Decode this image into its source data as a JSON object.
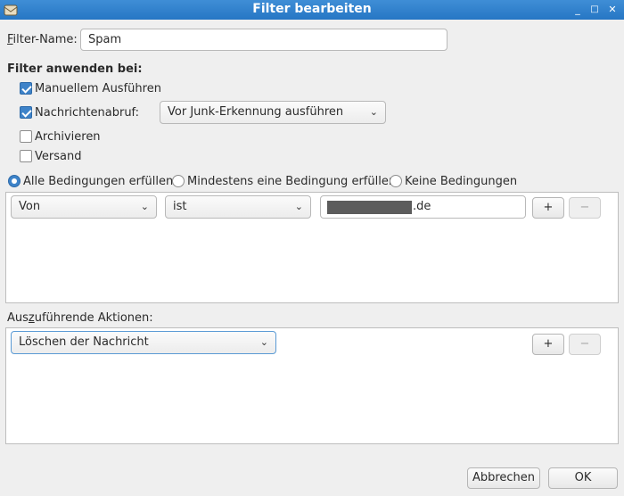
{
  "window": {
    "title": "Filter bearbeiten",
    "minimize": "_",
    "maximize": "□",
    "close": "✕"
  },
  "filter_name": {
    "label": "Filter-Name:",
    "value": "Spam"
  },
  "apply": {
    "heading": "Filter anwenden bei:",
    "manual": {
      "label": "Manuellem Ausführen",
      "checked": true
    },
    "fetch": {
      "label": "Nachrichtenabruf:",
      "checked": true,
      "select": "Vor Junk-Erkennung ausführen"
    },
    "archive": {
      "label": "Archivieren",
      "checked": false
    },
    "send": {
      "label": "Versand",
      "checked": false
    }
  },
  "match": {
    "all": "Alle Bedingungen erfüllen",
    "any": "Mindestens eine Bedingung erfüllen",
    "none": "Keine Bedingungen",
    "selected": "all"
  },
  "condition": {
    "field": "Von",
    "operator": "ist",
    "value": ".de",
    "add": "+",
    "remove": "−"
  },
  "actions": {
    "heading": "Auszuführende Aktionen:",
    "action": "Löschen der Nachricht",
    "add": "+",
    "remove": "−"
  },
  "footer": {
    "cancel": "Abbrechen",
    "ok": "OK"
  },
  "colors": {
    "titlebar": "#2b7bc9",
    "accent": "#3e83c9"
  }
}
